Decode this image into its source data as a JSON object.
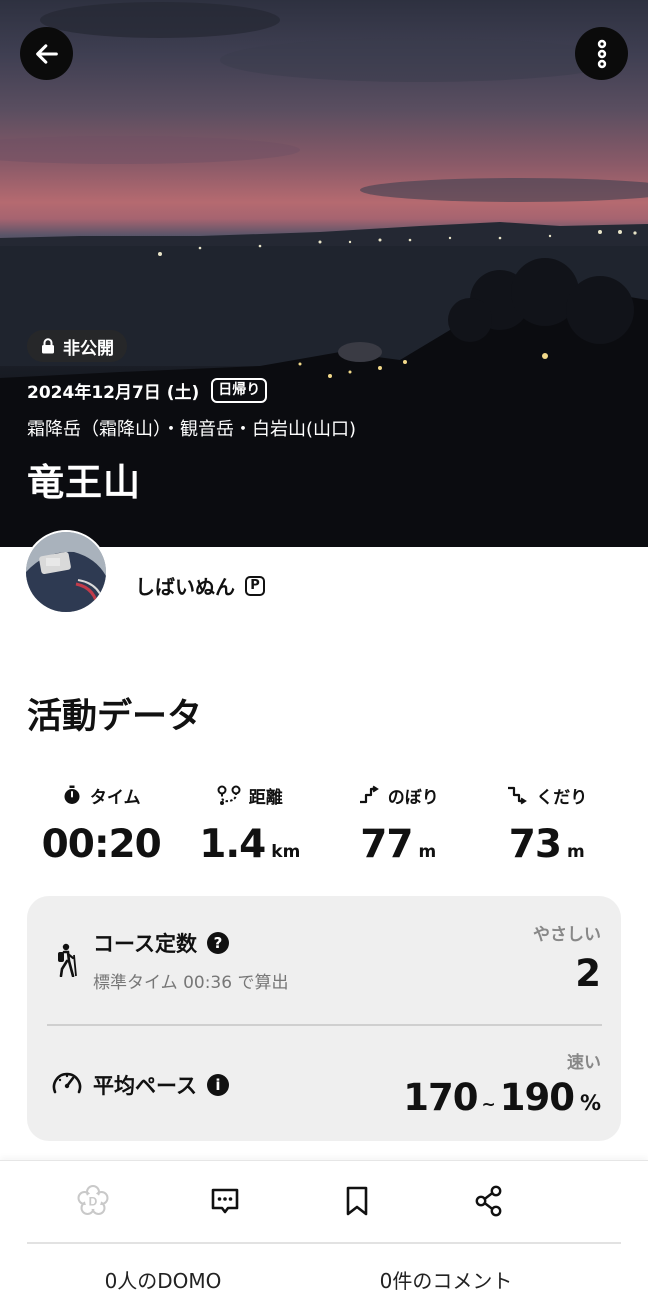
{
  "header": {
    "privacy_label": "非公開",
    "date": "2024年12月7日 (土)",
    "trip_type": "日帰り",
    "mountains": "霜降岳（霜降山）・観音岳・白岩山(山口)",
    "title": "竜王山"
  },
  "user": {
    "name": "しばいぬん",
    "badge": "P"
  },
  "activity": {
    "section_title": "活動データ",
    "stats": [
      {
        "label": "タイム",
        "value": "00:20",
        "unit": ""
      },
      {
        "label": "距離",
        "value": "1.4",
        "unit": "km"
      },
      {
        "label": "のぼり",
        "value": "77",
        "unit": "m"
      },
      {
        "label": "くだり",
        "value": "73",
        "unit": "m"
      }
    ],
    "course": {
      "title": "コース定数",
      "help": "?",
      "subtitle": "標準タイム 00:36 で算出",
      "difficulty_label": "やさしい",
      "value": "2"
    },
    "pace": {
      "title": "平均ペース",
      "info": "i",
      "speed_label": "速い",
      "min": "170",
      "separator": "~",
      "max": "190",
      "unit": "%"
    }
  },
  "footer": {
    "domo_count": "0人のDOMO",
    "comment_count": "0件のコメント"
  }
}
